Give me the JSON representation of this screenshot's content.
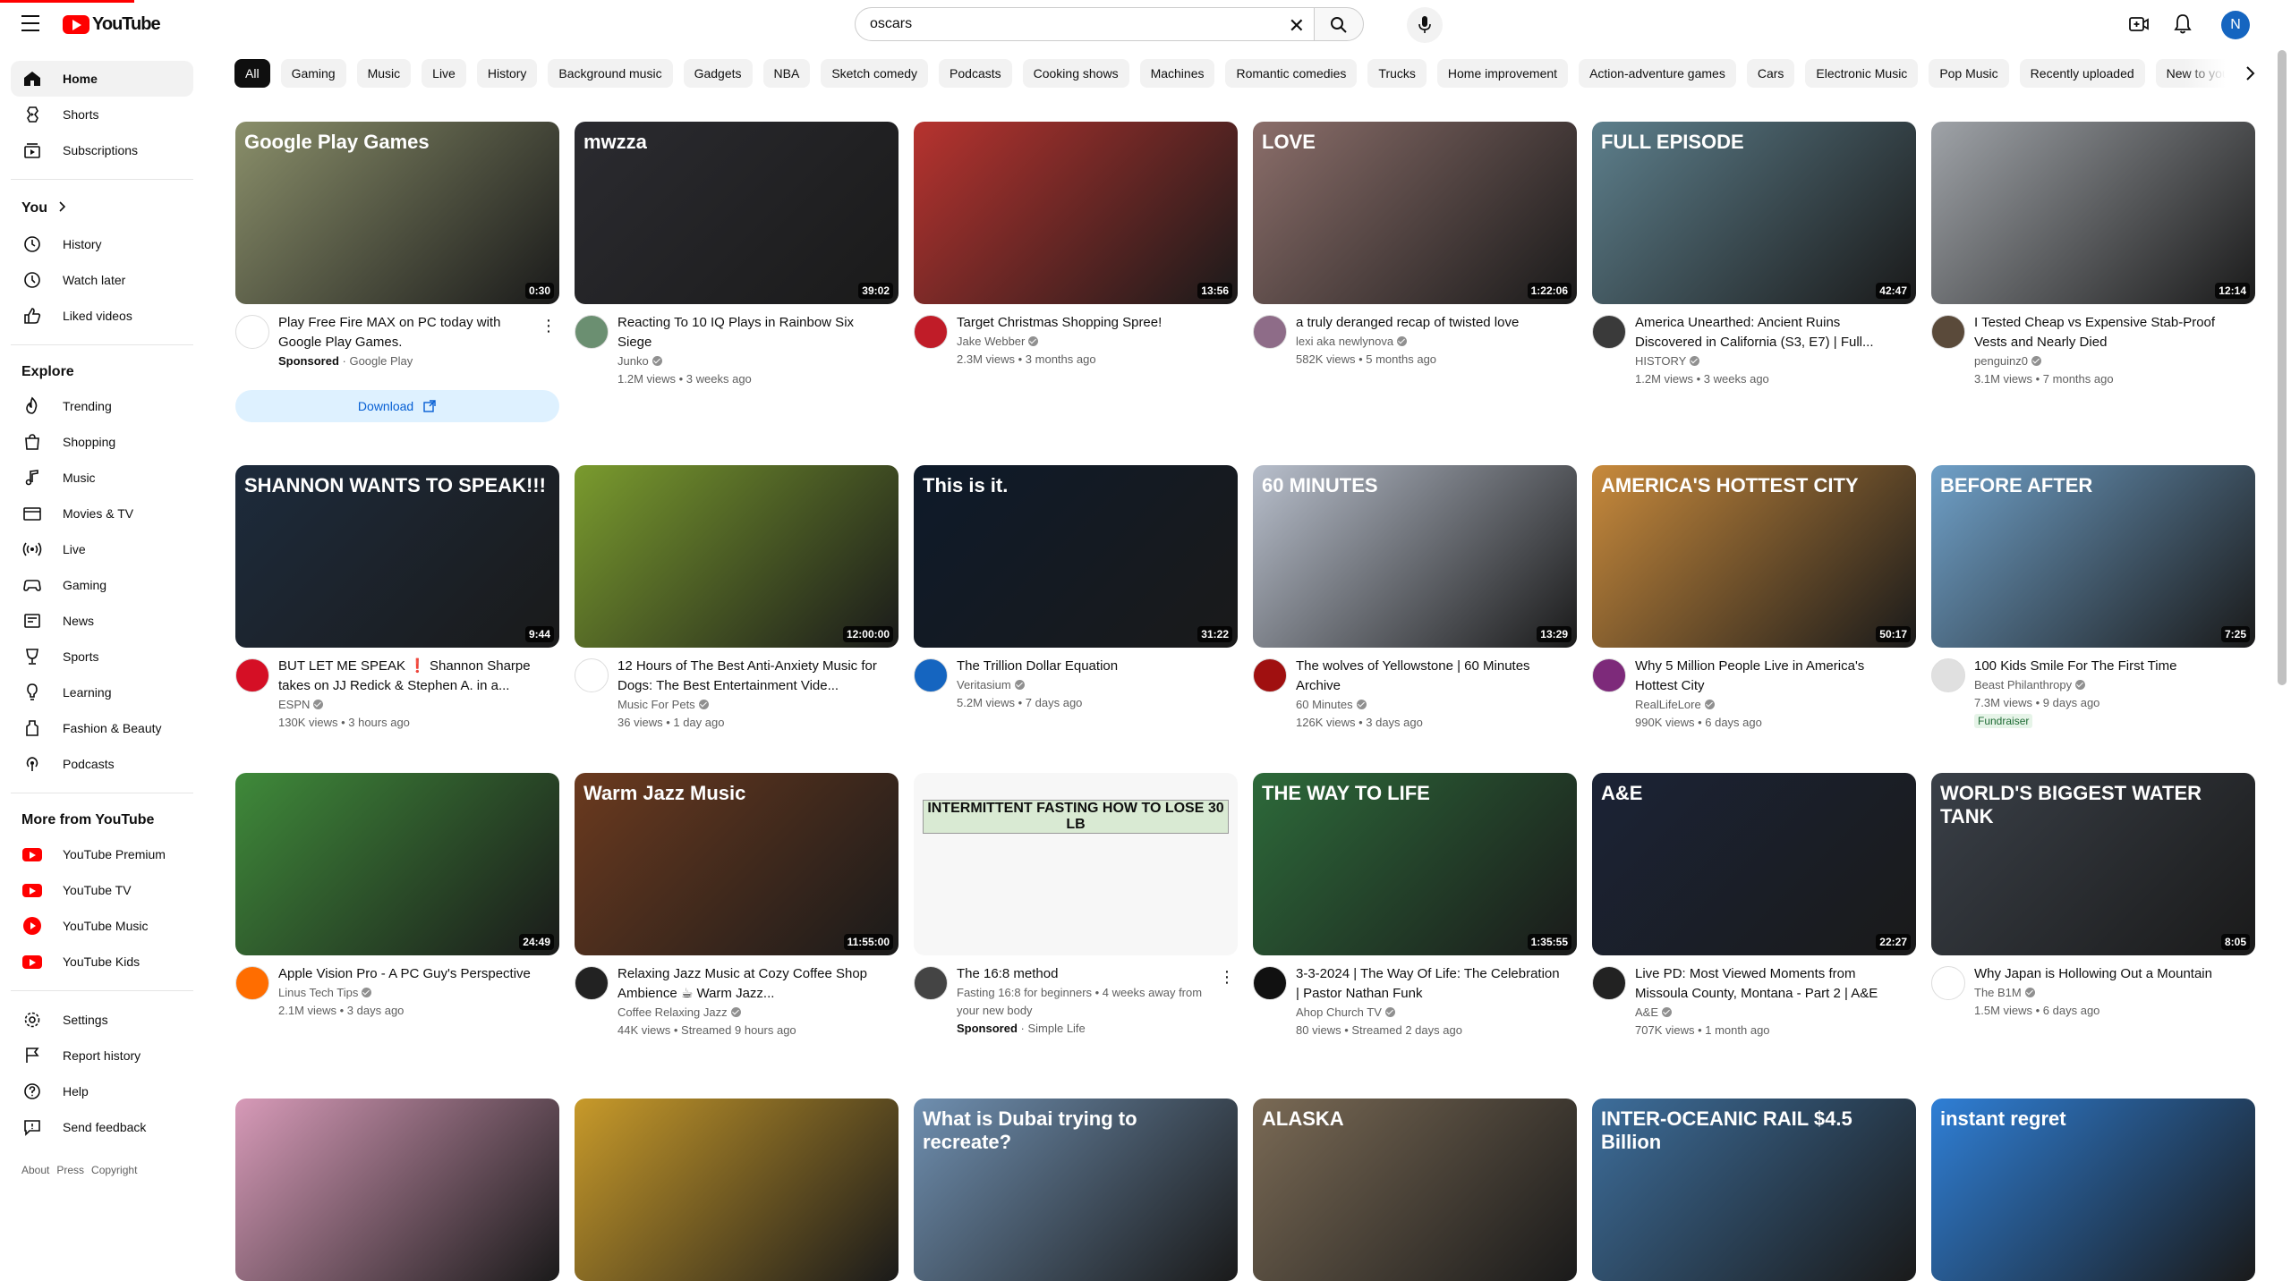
{
  "header": {
    "logo_text": "YouTube",
    "search_value": "oscars",
    "avatar_letter": "N"
  },
  "sidebar": {
    "main": [
      {
        "label": "Home",
        "icon": "home-icon"
      },
      {
        "label": "Shorts",
        "icon": "shorts-icon"
      },
      {
        "label": "Subscriptions",
        "icon": "subscriptions-icon"
      }
    ],
    "you_heading": "You",
    "you": [
      {
        "label": "History",
        "icon": "history-icon"
      },
      {
        "label": "Watch later",
        "icon": "watch-later-icon"
      },
      {
        "label": "Liked videos",
        "icon": "like-icon"
      }
    ],
    "explore_heading": "Explore",
    "explore": [
      {
        "label": "Trending",
        "icon": "trending-icon"
      },
      {
        "label": "Shopping",
        "icon": "shopping-icon"
      },
      {
        "label": "Music",
        "icon": "music-icon"
      },
      {
        "label": "Movies & TV",
        "icon": "movies-icon"
      },
      {
        "label": "Live",
        "icon": "live-icon"
      },
      {
        "label": "Gaming",
        "icon": "gaming-icon"
      },
      {
        "label": "News",
        "icon": "news-icon"
      },
      {
        "label": "Sports",
        "icon": "sports-icon"
      },
      {
        "label": "Learning",
        "icon": "learning-icon"
      },
      {
        "label": "Fashion & Beauty",
        "icon": "fashion-icon"
      },
      {
        "label": "Podcasts",
        "icon": "podcasts-icon"
      }
    ],
    "more_heading": "More from YouTube",
    "more": [
      {
        "label": "YouTube Premium",
        "icon": "youtube-premium-icon"
      },
      {
        "label": "YouTube TV",
        "icon": "youtube-tv-icon"
      },
      {
        "label": "YouTube Music",
        "icon": "youtube-music-icon"
      },
      {
        "label": "YouTube Kids",
        "icon": "youtube-kids-icon"
      }
    ],
    "settings": [
      {
        "label": "Settings",
        "icon": "settings-icon"
      },
      {
        "label": "Report history",
        "icon": "flag-icon"
      },
      {
        "label": "Help",
        "icon": "help-icon"
      },
      {
        "label": "Send feedback",
        "icon": "feedback-icon"
      }
    ],
    "footer": [
      "About",
      "Press",
      "Copyright"
    ]
  },
  "chips": [
    "All",
    "Gaming",
    "Music",
    "Live",
    "History",
    "Background music",
    "Gadgets",
    "NBA",
    "Sketch comedy",
    "Podcasts",
    "Cooking shows",
    "Machines",
    "Romantic comedies",
    "Trucks",
    "Home improvement",
    "Action-adventure games",
    "Cars",
    "Electronic Music",
    "Pop Music",
    "Recently uploaded",
    "New to you"
  ],
  "videos": [
    {
      "title": "Play Free Fire MAX on PC today with Google Play Games.",
      "line1": "",
      "line2": "",
      "channel": "Google Play",
      "sponsored": "Sponsored",
      "duration": "0:30",
      "download": "Download",
      "thumb_text": "Google Play Games",
      "thumb_bg": "#8a8f6a"
    },
    {
      "title": "Reacting To 10 IQ Plays in Rainbow Six Siege",
      "channel": "Junko",
      "line2": "1.2M views • 3 weeks ago",
      "duration": "39:02",
      "thumb_text": "mwzza",
      "thumb_bg": "#2b2b30"
    },
    {
      "title": "Target Christmas Shopping Spree!",
      "channel": "Jake Webber",
      "line2": "2.3M views • 3 months ago",
      "duration": "13:56",
      "thumb_text": "",
      "thumb_bg": "#b7332f"
    },
    {
      "title": "a truly deranged recap of twisted love",
      "channel": "lexi aka newlynova",
      "line2": "582K views • 5 months ago",
      "duration": "1:22:06",
      "thumb_text": "LOVE",
      "thumb_bg": "#8b6e6a"
    },
    {
      "title": "America Unearthed: Ancient Ruins Discovered in California (S3, E7) | Full...",
      "channel": "HISTORY",
      "line2": "1.2M views • 3 weeks ago",
      "duration": "42:47",
      "thumb_text": "FULL EPISODE",
      "thumb_bg": "#5d7f8c"
    },
    {
      "title": "I Tested Cheap vs Expensive Stab-Proof Vests and Nearly Died",
      "channel": "penguinz0",
      "line2": "3.1M views • 7 months ago",
      "duration": "12:14",
      "thumb_text": "",
      "thumb_bg": "#9fa3a8"
    },
    {
      "title": "BUT LET ME SPEAK ❗ Shannon Sharpe takes on JJ Redick & Stephen A. in a...",
      "channel": "ESPN",
      "line2": "130K views • 3 hours ago",
      "duration": "9:44",
      "thumb_text": "SHANNON WANTS TO SPEAK!!!",
      "thumb_bg": "#1d2b3c"
    },
    {
      "title": "12 Hours of The Best Anti-Anxiety Music for Dogs: The Best Entertainment Vide...",
      "channel": "Music For Pets",
      "line2": "36 views • 1 day ago",
      "duration": "12:00:00",
      "thumb_text": "",
      "thumb_bg": "#7a9b2e"
    },
    {
      "title": "The Trillion Dollar Equation",
      "channel": "Veritasium",
      "line2": "5.2M views • 7 days ago",
      "duration": "31:22",
      "thumb_text": "This is it.",
      "thumb_bg": "#0e1a2a"
    },
    {
      "title": "The wolves of Yellowstone | 60 Minutes Archive",
      "channel": "60 Minutes",
      "line2": "126K views • 3 days ago",
      "duration": "13:29",
      "thumb_text": "60 MINUTES",
      "thumb_bg": "#b8bfcc"
    },
    {
      "title": "Why 5 Million People Live in America's Hottest City",
      "channel": "RealLifeLore",
      "line2": "990K views • 6 days ago",
      "duration": "50:17",
      "thumb_text": "AMERICA'S HOTTEST CITY",
      "thumb_bg": "#c88a3c"
    },
    {
      "title": "100 Kids Smile For The First Time",
      "channel": "Beast Philanthropy",
      "line2": "7.3M views • 9 days ago",
      "badge": "Fundraiser",
      "duration": "7:25",
      "thumb_text": "BEFORE      AFTER",
      "thumb_bg": "#6fa0c8"
    },
    {
      "title": "Apple Vision Pro - A PC Guy's Perspective",
      "channel": "Linus Tech Tips",
      "line2": "2.1M views • 3 days ago",
      "duration": "24:49",
      "thumb_text": "",
      "thumb_bg": "#3f8a3a"
    },
    {
      "title": "Relaxing Jazz Music at Cozy Coffee Shop Ambience ☕ Warm Jazz...",
      "channel": "Coffee Relaxing Jazz",
      "line2": "44K views • Streamed 9 hours ago",
      "duration": "11:55:00",
      "thumb_text": "Warm Jazz Music",
      "thumb_bg": "#6b3a1f"
    },
    {
      "title": "The 16:8 method",
      "channel": "Simple Life",
      "desc": "Fasting 16:8 for beginners • 4 weeks away from your new body",
      "sponsored": "Sponsored",
      "duration": "",
      "thumb_text": "INTERMITTENT FASTING HOW TO LOSE 30 LB",
      "thumb_bg": "#f2f2f2"
    },
    {
      "title": "3-3-2024 | The Way Of Life: The Celebration | Pastor Nathan Funk",
      "channel": "Ahop Church TV",
      "line2": "80 views • Streamed 2 days ago",
      "duration": "1:35:55",
      "thumb_text": "THE WAY TO LIFE",
      "thumb_bg": "#2d6a3a"
    },
    {
      "title": "Live PD: Most Viewed Moments from Missoula County, Montana - Part 2 | A&E",
      "channel": "A&E",
      "line2": "707K views • 1 month ago",
      "duration": "22:27",
      "thumb_text": "A&E",
      "thumb_bg": "#1b2336"
    },
    {
      "title": "Why Japan is Hollowing Out a Mountain",
      "channel": "The B1M",
      "line2": "1.5M views • 6 days ago",
      "duration": "8:05",
      "thumb_text": "WORLD'S BIGGEST WATER TANK",
      "thumb_bg": "#3a4048"
    },
    {
      "title": "",
      "channel": "",
      "line2": "",
      "duration": "",
      "thumb_text": "",
      "thumb_bg": "#d79ab8"
    },
    {
      "title": "",
      "channel": "",
      "line2": "",
      "duration": "",
      "thumb_text": "",
      "thumb_bg": "#c89a2a"
    },
    {
      "title": "",
      "channel": "",
      "line2": "",
      "duration": "",
      "thumb_text": "What is Dubai trying to recreate?",
      "thumb_bg": "#6f8fb0"
    },
    {
      "title": "",
      "channel": "",
      "line2": "",
      "duration": "",
      "thumb_text": "ALASKA",
      "thumb_bg": "#7a6a55"
    },
    {
      "title": "",
      "channel": "",
      "line2": "",
      "duration": "",
      "thumb_text": "INTER-OCEANIC RAIL $4.5 Billion",
      "thumb_bg": "#3d6e9c"
    },
    {
      "title": "",
      "channel": "",
      "line2": "",
      "duration": "",
      "thumb_text": "instant regret",
      "thumb_bg": "#2f7fd6"
    }
  ]
}
